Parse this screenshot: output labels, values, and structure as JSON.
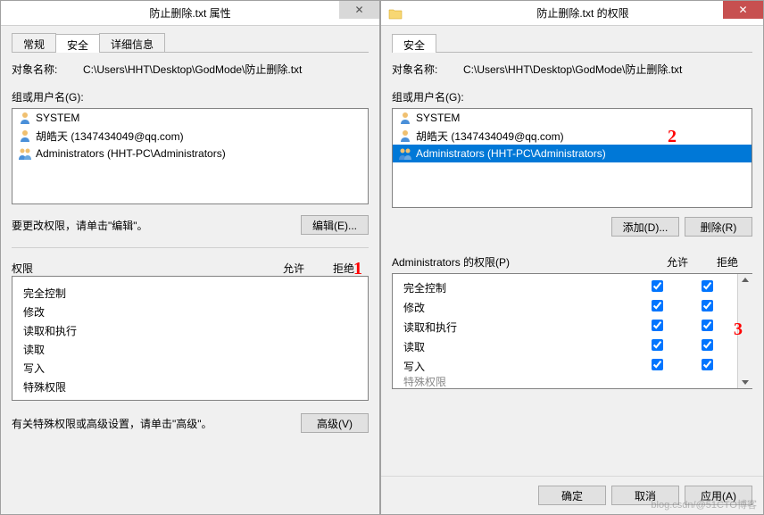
{
  "left": {
    "title": "防止删除.txt 属性",
    "tabs": [
      "常规",
      "安全",
      "详细信息"
    ],
    "active_tab": "安全",
    "object_label": "对象名称:",
    "object_path": "C:\\Users\\HHT\\Desktop\\GodMode\\防止删除.txt",
    "group_label": "组或用户名(G):",
    "users": [
      {
        "name": "SYSTEM",
        "icon": "user"
      },
      {
        "name": "胡皓天 (1347434049@qq.com)",
        "icon": "user"
      },
      {
        "name": "Administrators (HHT-PC\\Administrators)",
        "icon": "users"
      }
    ],
    "edit_note": "要更改权限，请单击\"编辑\"。",
    "edit_btn": "编辑(E)...",
    "perm_header": "权限",
    "allow_col": "允许",
    "deny_col": "拒绝",
    "perms": [
      "完全控制",
      "修改",
      "读取和执行",
      "读取",
      "写入",
      "特殊权限"
    ],
    "adv_note": "有关特殊权限或高级设置，请单击\"高级\"。",
    "adv_btn": "高级(V)"
  },
  "right": {
    "title": "防止删除.txt 的权限",
    "tab": "安全",
    "object_label": "对象名称:",
    "object_path": "C:\\Users\\HHT\\Desktop\\GodMode\\防止删除.txt",
    "group_label": "组或用户名(G):",
    "users": [
      {
        "name": "SYSTEM",
        "icon": "user",
        "selected": false
      },
      {
        "name": "胡皓天 (1347434049@qq.com)",
        "icon": "user",
        "selected": false
      },
      {
        "name": "Administrators (HHT-PC\\Administrators)",
        "icon": "users",
        "selected": true
      }
    ],
    "add_btn": "添加(D)...",
    "remove_btn": "删除(R)",
    "perm_for_label": "Administrators 的权限(P)",
    "allow_col": "允许",
    "deny_col": "拒绝",
    "perms": [
      {
        "name": "完全控制",
        "allow": true,
        "deny": true
      },
      {
        "name": "修改",
        "allow": true,
        "deny": true
      },
      {
        "name": "读取和执行",
        "allow": true,
        "deny": true
      },
      {
        "name": "读取",
        "allow": true,
        "deny": true
      },
      {
        "name": "写入",
        "allow": true,
        "deny": true
      },
      {
        "name": "特殊权限",
        "allow": false,
        "deny": false
      }
    ],
    "ok_btn": "确定",
    "cancel_btn": "取消",
    "apply_btn": "应用(A)"
  },
  "annotations": {
    "a1": "1",
    "a2": "2",
    "a3": "3"
  },
  "watermark": "blog.csdn/@51CTO博客"
}
